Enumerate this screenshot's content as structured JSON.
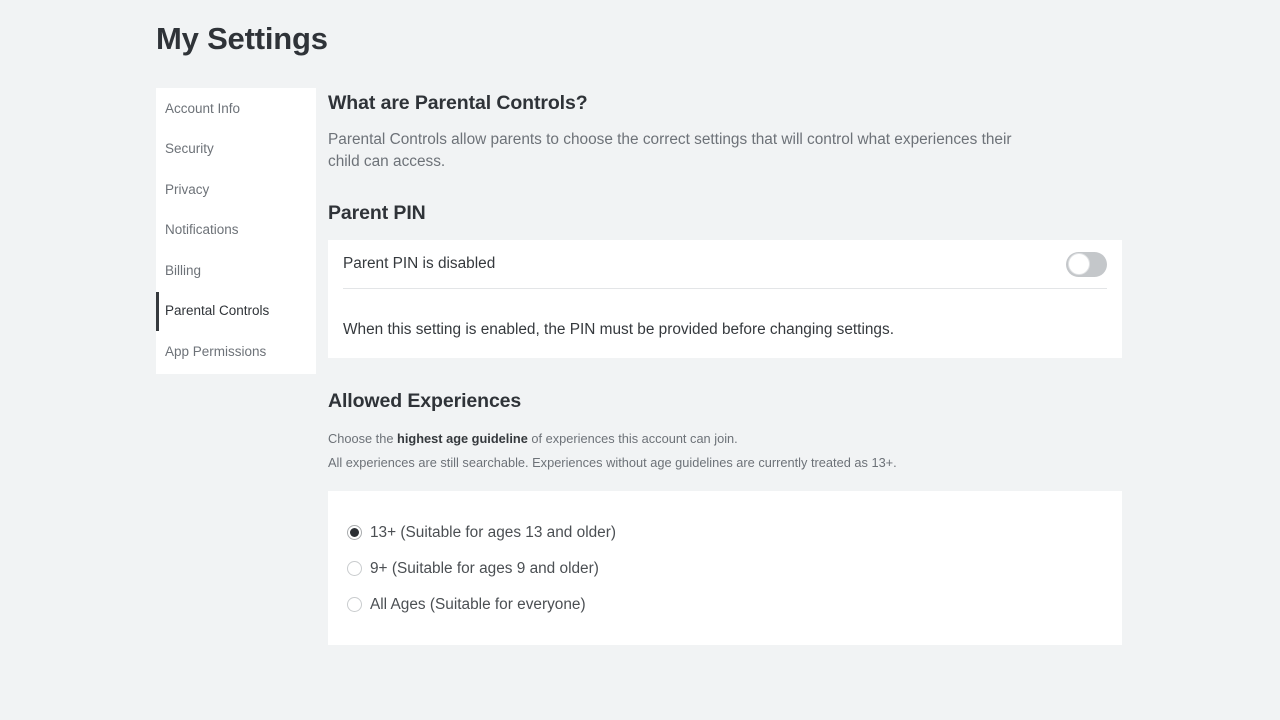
{
  "page": {
    "title": "My Settings"
  },
  "sidebar": {
    "items": [
      {
        "label": "Account Info",
        "active": false
      },
      {
        "label": "Security",
        "active": false
      },
      {
        "label": "Privacy",
        "active": false
      },
      {
        "label": "Notifications",
        "active": false
      },
      {
        "label": "Billing",
        "active": false
      },
      {
        "label": "Parental Controls",
        "active": true
      },
      {
        "label": "App Permissions",
        "active": false
      }
    ]
  },
  "main": {
    "intro": {
      "heading": "What are Parental Controls?",
      "body": "Parental Controls allow parents to choose the correct settings that will control what experiences their child can access."
    },
    "parent_pin": {
      "heading": "Parent PIN",
      "status_label": "Parent PIN is disabled",
      "description": "When this setting is enabled, the PIN must be provided before changing settings.",
      "toggle": {
        "state": "off",
        "track_color": "#c4c7ca",
        "knob_color": "#ffffff"
      }
    },
    "allowed_experiences": {
      "heading": "Allowed Experiences",
      "description_prefix": "Choose the ",
      "description_bold": "highest age guideline",
      "description_suffix": " of experiences this account can join.",
      "note": "All experiences are still searchable. Experiences without age guidelines are currently treated as 13+.",
      "options": [
        {
          "label": "13+ (Suitable for ages 13 and older)",
          "selected": true
        },
        {
          "label": "9+ (Suitable for ages 9 and older)",
          "selected": false
        },
        {
          "label": "All Ages (Suitable for everyone)",
          "selected": false
        }
      ]
    }
  },
  "colors": {
    "page_background": "#f1f3f4",
    "card_background": "#ffffff",
    "heading_text": "#2f3338",
    "muted_text": "#6d7278",
    "active_indicator": "#35393d",
    "radio_selected": "#2b2f33"
  }
}
